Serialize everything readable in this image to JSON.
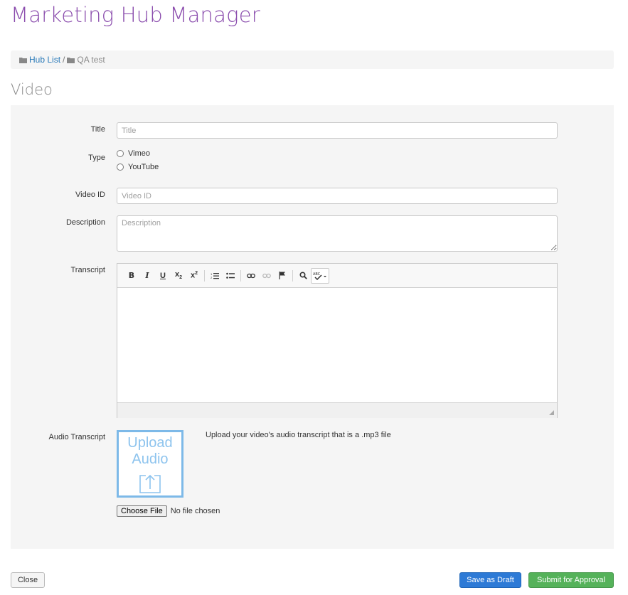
{
  "header": {
    "title": "Marketing Hub Manager"
  },
  "breadcrumb": {
    "items": [
      {
        "label": "Hub List",
        "icon": "folder-icon",
        "link": true
      },
      {
        "label": "QA test",
        "icon": "folder-icon",
        "link": false
      }
    ],
    "separator": "/"
  },
  "section": {
    "title": "Video"
  },
  "form": {
    "title": {
      "label": "Title",
      "placeholder": "Title",
      "value": ""
    },
    "type": {
      "label": "Type",
      "options": [
        "Vimeo",
        "YouTube"
      ],
      "selected": null
    },
    "video_id": {
      "label": "Video ID",
      "placeholder": "Video ID",
      "value": ""
    },
    "description": {
      "label": "Description",
      "placeholder": "Description",
      "value": ""
    },
    "transcript": {
      "label": "Transcript",
      "toolbar": [
        "bold-icon",
        "italic-icon",
        "underline-icon",
        "subscript-icon",
        "superscript-icon",
        "numbered-list-icon",
        "bulleted-list-icon",
        "link-icon",
        "unlink-icon",
        "anchor-flag-icon",
        "find-icon",
        "spellcheck-icon"
      ]
    },
    "audio_transcript": {
      "label": "Audio Transcript",
      "upload_line1": "Upload",
      "upload_line2": "Audio",
      "note": "Upload your video's audio transcript that is a .mp3 file",
      "choose_file": "Choose File",
      "file_status": "No file chosen"
    }
  },
  "actions": {
    "close": "Close",
    "save_draft": "Save as Draft",
    "submit": "Submit for Approval"
  },
  "colors": {
    "title": "#8a4cad",
    "link": "#2a7ab9",
    "upload_border": "#7db9e8",
    "draft_button": "#2d7ad6",
    "submit_button": "#55b25a"
  }
}
